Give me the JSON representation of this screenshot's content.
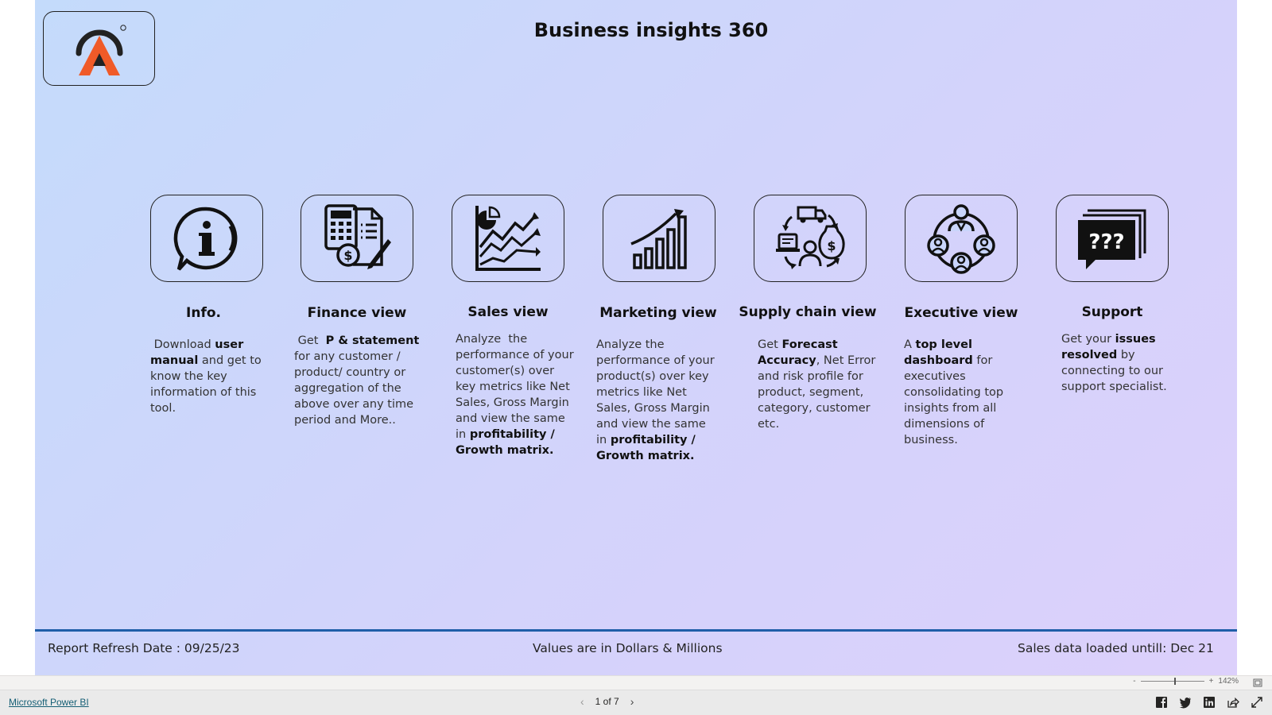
{
  "header": {
    "title": "Business insights 360",
    "logo_name": "atliq-logo"
  },
  "tiles": [
    {
      "icon": "info-icon",
      "title": "Info.",
      "desc_html": "&nbsp;Download <b>user manual</b> and get to know the key information of this tool."
    },
    {
      "icon": "finance-icon",
      "title": "Finance view",
      "desc_html": "&nbsp;Get &nbsp;<b>P &amp; statement</b> for any customer / product/ country or aggregation of the above over any time period and More.."
    },
    {
      "icon": "sales-chart-icon",
      "title": "Sales view",
      "desc_html": "Analyze &nbsp;the performance of your customer(s) over key metrics like Net Sales, Gross Margin and view the same in <b>profitability / Growth matrix.</b>"
    },
    {
      "icon": "bar-growth-icon",
      "title": "Marketing view",
      "desc_html": "Analyze the performance of your product(s) over key metrics like Net Sales, Gross Margin and view the same in <b>profitability / Growth matrix.</b>"
    },
    {
      "icon": "supply-chain-icon",
      "title": "Supply chain view",
      "desc_html": "Get <b>Forecast Accuracy</b>, Net Error and risk profile for product, segment, category, customer etc."
    },
    {
      "icon": "executive-network-icon",
      "title": "Executive view",
      "desc_html": "A <b>top level dashboard</b> for executives consolidating top insights from all dimensions of business."
    },
    {
      "icon": "support-chat-icon",
      "title": "Support",
      "desc_html": "Get your <b>issues resolved</b> by connecting to our support specialist."
    }
  ],
  "footer": {
    "refresh_label": "Report Refresh Date :",
    "refresh_date": "09/25/23",
    "values_note": "Values are in Dollars & Millions",
    "sales_loaded": "Sales data loaded untill: Dec 21"
  },
  "status": {
    "brand_link": "Microsoft Power BI",
    "page_indicator": "1 of 7",
    "prev_glyph": "‹",
    "next_glyph": "›",
    "zoom_level": "142%",
    "zoom_minus": "-",
    "zoom_plus": "+",
    "zoom_fraction": 0.55,
    "share_icons": [
      "facebook-icon",
      "twitter-icon",
      "linkedin-icon",
      "share-icon",
      "fullscreen-icon"
    ]
  },
  "colors": {
    "accent_line": "#1f5ea8",
    "logo_orange": "#f05a28",
    "logo_dark": "#222222"
  }
}
